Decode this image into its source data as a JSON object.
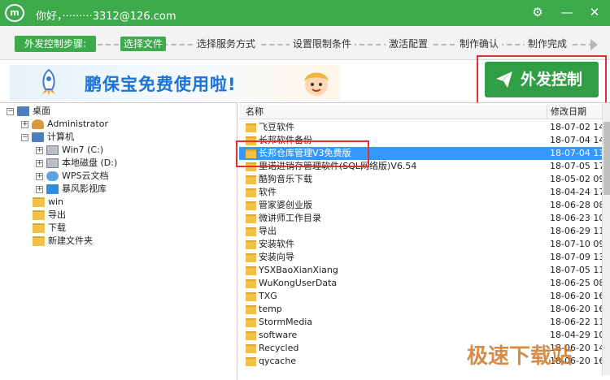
{
  "titlebar": {
    "logo_text": "m",
    "title": "你好，·········3312@126.com",
    "settings_icon": "gear-icon",
    "minimize_icon": "minimize-icon",
    "close_icon": "close-icon"
  },
  "steps": {
    "prefix": "外发控制步骤:",
    "items": [
      "选择文件",
      "选择服务方式",
      "设置限制条件",
      "激活配置",
      "制作确认",
      "制作完成"
    ]
  },
  "banner": {
    "text": "鹏保宝免费使用啦!"
  },
  "action_button": {
    "label": "外发控制"
  },
  "tree": {
    "desktop": "桌面",
    "administrator": "Administrator",
    "computer": "计算机",
    "win7": "Win7 (C:)",
    "local_d": "本地磁盘 (D:)",
    "wps": "WPS云文档",
    "video": "暴风影视库",
    "win": "win",
    "export": "导出",
    "download": "下载",
    "new_folder": "新建文件夹"
  },
  "file_list": {
    "header_name": "名称",
    "header_date": "修改日期",
    "rows": [
      {
        "name": "飞豆软件",
        "date": "18-07-02 14:"
      },
      {
        "name": "长邦软件备份",
        "date": "18-07-04 14:"
      },
      {
        "name": "长邦仓库管理V3免费版",
        "date": "18-07-04 13:"
      },
      {
        "name": "里诺进销存管理软件(SQL网络版)V6.54",
        "date": "18-07-05 17:"
      },
      {
        "name": "酷狗音乐下载",
        "date": "18-05-02 09:"
      },
      {
        "name": "软件",
        "date": "18-04-24 17:"
      },
      {
        "name": "管家婆创业版",
        "date": "18-06-28 08:"
      },
      {
        "name": "微讲师工作目录",
        "date": "18-06-23 10:"
      },
      {
        "name": "导出",
        "date": "18-06-29 11:"
      },
      {
        "name": "安装软件",
        "date": "18-07-10 09:"
      },
      {
        "name": "安装向导",
        "date": "18-07-09 13:"
      },
      {
        "name": "YSXBaoXianXiang",
        "date": "18-07-05 11:"
      },
      {
        "name": "WuKongUserData",
        "date": "18-06-25 08:"
      },
      {
        "name": "TXG",
        "date": "18-06-20 16:"
      },
      {
        "name": "temp",
        "date": "18-06-20 16:"
      },
      {
        "name": "StormMedia",
        "date": "18-06-22 11:"
      },
      {
        "name": "software",
        "date": "18-04-29 10:"
      },
      {
        "name": "Recycled",
        "date": "18-06-20 14:"
      },
      {
        "name": "qycache",
        "date": "18-06-20 16:"
      }
    ],
    "selected_index": 2
  },
  "watermark": "极速下载站"
}
